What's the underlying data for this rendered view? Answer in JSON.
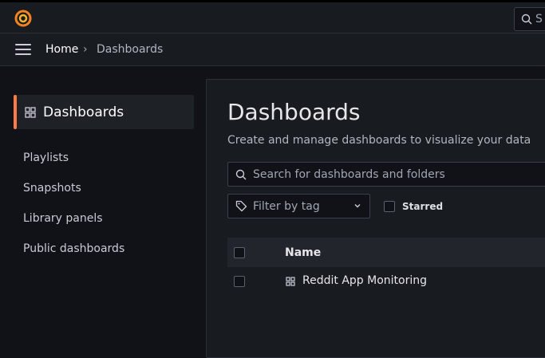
{
  "topbar": {
    "search_label": "S"
  },
  "breadcrumb": {
    "home": "Home",
    "separator": "›",
    "current": "Dashboards"
  },
  "sidebar": {
    "active": "Dashboards",
    "items": [
      {
        "label": "Playlists"
      },
      {
        "label": "Snapshots"
      },
      {
        "label": "Library panels"
      },
      {
        "label": "Public dashboards"
      }
    ]
  },
  "main": {
    "title": "Dashboards",
    "subtitle": "Create and manage dashboards to visualize your data",
    "search_placeholder": "Search for dashboards and folders",
    "filter_label": "Filter by tag",
    "starred_label": "Starred",
    "table_header": "Name",
    "rows": [
      {
        "name": "Reddit App Monitoring"
      }
    ]
  },
  "colors": {
    "accent": "#ff7a45",
    "background": "#111217",
    "panel": "#181b1f"
  }
}
